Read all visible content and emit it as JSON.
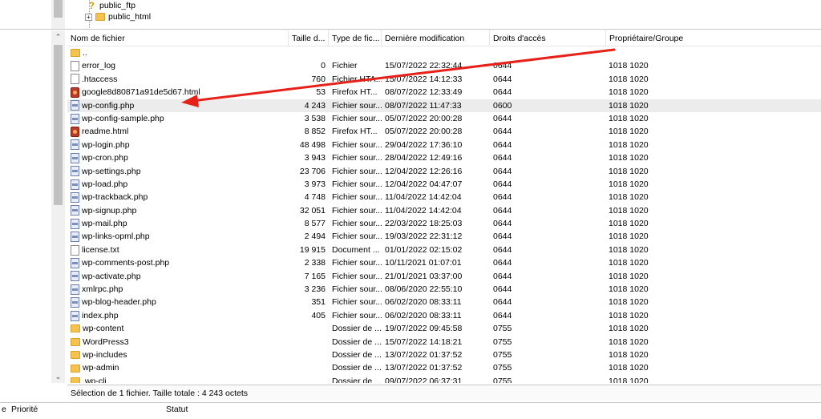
{
  "tree": {
    "items": [
      {
        "label": "public_ftp",
        "icon": "question-folder-icon"
      },
      {
        "label": "public_html",
        "icon": "folder-icon"
      }
    ]
  },
  "columns": {
    "name": "Nom de fichier",
    "size": "Taille d...",
    "type": "Type de fic...",
    "modified": "Dernière modification",
    "perms": "Droits d'accès",
    "owner": "Propriétaire/Groupe"
  },
  "files": [
    {
      "name": "..",
      "size": "",
      "type": "",
      "modified": "",
      "perms": "",
      "owner": "",
      "icon": "folder"
    },
    {
      "name": "error_log",
      "size": "0",
      "type": "Fichier",
      "modified": "15/07/2022 22:32:44",
      "perms": "0644",
      "owner": "1018 1020",
      "icon": "doc"
    },
    {
      "name": ".htaccess",
      "size": "760",
      "type": "Fichier HTA...",
      "modified": "15/07/2022 14:12:33",
      "perms": "0644",
      "owner": "1018 1020",
      "icon": "doc"
    },
    {
      "name": "google8d80871a91de5d67.html",
      "size": "53",
      "type": "Firefox HT...",
      "modified": "08/07/2022 12:33:49",
      "perms": "0644",
      "owner": "1018 1020",
      "icon": "html"
    },
    {
      "name": "wp-config.php",
      "size": "4 243",
      "type": "Fichier sour...",
      "modified": "08/07/2022 11:47:33",
      "perms": "0600",
      "owner": "1018 1020",
      "icon": "php",
      "selected": true
    },
    {
      "name": "wp-config-sample.php",
      "size": "3 538",
      "type": "Fichier sour...",
      "modified": "05/07/2022 20:00:28",
      "perms": "0644",
      "owner": "1018 1020",
      "icon": "php"
    },
    {
      "name": "readme.html",
      "size": "8 852",
      "type": "Firefox HT...",
      "modified": "05/07/2022 20:00:28",
      "perms": "0644",
      "owner": "1018 1020",
      "icon": "html"
    },
    {
      "name": "wp-login.php",
      "size": "48 498",
      "type": "Fichier sour...",
      "modified": "29/04/2022 17:36:10",
      "perms": "0644",
      "owner": "1018 1020",
      "icon": "php"
    },
    {
      "name": "wp-cron.php",
      "size": "3 943",
      "type": "Fichier sour...",
      "modified": "28/04/2022 12:49:16",
      "perms": "0644",
      "owner": "1018 1020",
      "icon": "php"
    },
    {
      "name": "wp-settings.php",
      "size": "23 706",
      "type": "Fichier sour...",
      "modified": "12/04/2022 12:26:16",
      "perms": "0644",
      "owner": "1018 1020",
      "icon": "php"
    },
    {
      "name": "wp-load.php",
      "size": "3 973",
      "type": "Fichier sour...",
      "modified": "12/04/2022 04:47:07",
      "perms": "0644",
      "owner": "1018 1020",
      "icon": "php"
    },
    {
      "name": "wp-trackback.php",
      "size": "4 748",
      "type": "Fichier sour...",
      "modified": "11/04/2022 14:42:04",
      "perms": "0644",
      "owner": "1018 1020",
      "icon": "php"
    },
    {
      "name": "wp-signup.php",
      "size": "32 051",
      "type": "Fichier sour...",
      "modified": "11/04/2022 14:42:04",
      "perms": "0644",
      "owner": "1018 1020",
      "icon": "php"
    },
    {
      "name": "wp-mail.php",
      "size": "8 577",
      "type": "Fichier sour...",
      "modified": "22/03/2022 18:25:03",
      "perms": "0644",
      "owner": "1018 1020",
      "icon": "php"
    },
    {
      "name": "wp-links-opml.php",
      "size": "2 494",
      "type": "Fichier sour...",
      "modified": "19/03/2022 22:31:12",
      "perms": "0644",
      "owner": "1018 1020",
      "icon": "php"
    },
    {
      "name": "license.txt",
      "size": "19 915",
      "type": "Document ...",
      "modified": "01/01/2022 02:15:02",
      "perms": "0644",
      "owner": "1018 1020",
      "icon": "doc"
    },
    {
      "name": "wp-comments-post.php",
      "size": "2 338",
      "type": "Fichier sour...",
      "modified": "10/11/2021 01:07:01",
      "perms": "0644",
      "owner": "1018 1020",
      "icon": "php"
    },
    {
      "name": "wp-activate.php",
      "size": "7 165",
      "type": "Fichier sour...",
      "modified": "21/01/2021 03:37:00",
      "perms": "0644",
      "owner": "1018 1020",
      "icon": "php"
    },
    {
      "name": "xmlrpc.php",
      "size": "3 236",
      "type": "Fichier sour...",
      "modified": "08/06/2020 22:55:10",
      "perms": "0644",
      "owner": "1018 1020",
      "icon": "php"
    },
    {
      "name": "wp-blog-header.php",
      "size": "351",
      "type": "Fichier sour...",
      "modified": "06/02/2020 08:33:11",
      "perms": "0644",
      "owner": "1018 1020",
      "icon": "php"
    },
    {
      "name": "index.php",
      "size": "405",
      "type": "Fichier sour...",
      "modified": "06/02/2020 08:33:11",
      "perms": "0644",
      "owner": "1018 1020",
      "icon": "php"
    },
    {
      "name": "wp-content",
      "size": "",
      "type": "Dossier de ...",
      "modified": "19/07/2022 09:45:58",
      "perms": "0755",
      "owner": "1018 1020",
      "icon": "folder"
    },
    {
      "name": "WordPress3",
      "size": "",
      "type": "Dossier de ...",
      "modified": "15/07/2022 14:18:21",
      "perms": "0755",
      "owner": "1018 1020",
      "icon": "folder"
    },
    {
      "name": "wp-includes",
      "size": "",
      "type": "Dossier de ...",
      "modified": "13/07/2022 01:37:52",
      "perms": "0755",
      "owner": "1018 1020",
      "icon": "folder"
    },
    {
      "name": "wp-admin",
      "size": "",
      "type": "Dossier de ...",
      "modified": "13/07/2022 01:37:52",
      "perms": "0755",
      "owner": "1018 1020",
      "icon": "folder"
    },
    {
      "name": ".wp-cli",
      "size": "",
      "type": "Dossier de ...",
      "modified": "09/07/2022 06:37:31",
      "perms": "0755",
      "owner": "1018 1020",
      "icon": "folder"
    }
  ],
  "status_text": "Sélection de 1 fichier. Taille totale : 4 243 octets",
  "queue": {
    "col1": "e",
    "col2": "Priorité",
    "col3": "Statut"
  },
  "annotation": {
    "color": "#e8201a"
  }
}
